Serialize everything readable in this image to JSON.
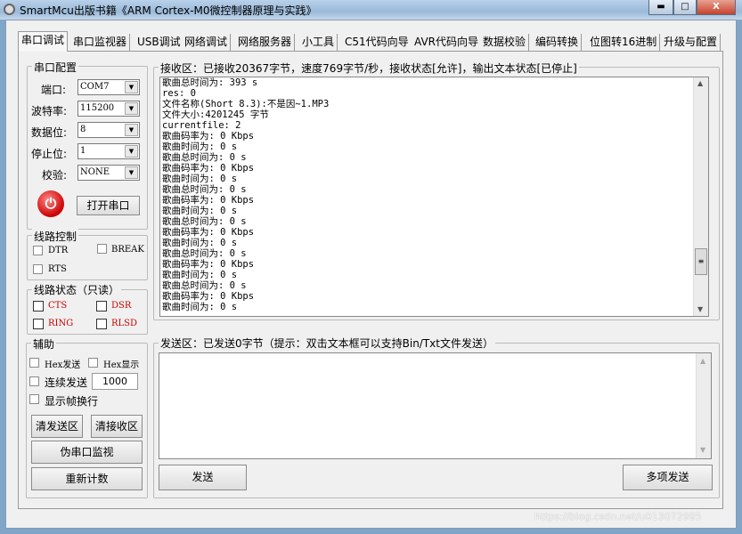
{
  "window": {
    "title": "SmartMcu出版书籍《ARM Cortex-M0微控制器原理与实践》",
    "minimize": "▬",
    "maximize": "□",
    "close": "X"
  },
  "tabs": [
    "串口调试",
    "串口监视器",
    "USB调试",
    "网络调试",
    "网络服务器",
    "小工具",
    "C51代码向导",
    "AVR代码向导",
    "数据校验",
    "编码转换",
    "位图转16进制",
    "升级与配置"
  ],
  "serial_config": {
    "title": "串口配置",
    "port_label": "端口:",
    "port": "COM7",
    "baud_label": "波特率:",
    "baud": "115200",
    "databits_label": "数据位:",
    "databits": "8",
    "stopbits_label": "停止位:",
    "stopbits": "1",
    "parity_label": "校验:",
    "parity": "NONE",
    "open_button": "打开串口"
  },
  "line_control": {
    "title": "线路控制",
    "dtr": "DTR",
    "break": "BREAK",
    "rts": "RTS"
  },
  "line_status": {
    "title": "线路状态（只读）",
    "cts": "CTS",
    "dsr": "DSR",
    "ring": "RING",
    "rlsd": "RLSD"
  },
  "aux": {
    "title": "辅助",
    "hex_send": "Hex发送",
    "hex_show": "Hex显示",
    "continuous_send": "连续发送",
    "interval": "1000",
    "show_frame_newline": "显示帧换行",
    "clear_send": "清发送区",
    "clear_recv": "清接收区",
    "pseudo_monitor": "伪串口监视",
    "reset_count": "重新计数"
  },
  "receive": {
    "title": "接收区：已接收20367字节，速度769字节/秒，接收状态[允许]，输出文本状态[已停止]",
    "lines": [
      "歌曲总时间为: 393 s",
      "res: 0",
      "文件名称(Short 8.3):不是因~1.MP3",
      "文件大小:4201245 字节",
      "currentfile: 2",
      "歌曲码率为: 0 Kbps",
      "歌曲时间为: 0 s",
      "歌曲总时间为: 0 s",
      "歌曲码率为: 0 Kbps",
      "歌曲时间为: 0 s",
      "歌曲总时间为: 0 s",
      "歌曲码率为: 0 Kbps",
      "歌曲时间为: 0 s",
      "歌曲总时间为: 0 s",
      "歌曲码率为: 0 Kbps",
      "歌曲时间为: 0 s",
      "歌曲总时间为: 0 s",
      "歌曲码率为: 0 Kbps",
      "歌曲时间为: 0 s",
      "歌曲总时间为: 0 s",
      "歌曲码率为: 0 Kbps",
      "歌曲时间为: 0 s"
    ]
  },
  "send": {
    "title": "发送区：已发送0字节（提示：双击文本框可以支持Bin/Txt文件发送）",
    "send_button": "发送",
    "multi_send_button": "多项发送"
  },
  "watermark": "https://blog.csdn.net/u013072995"
}
